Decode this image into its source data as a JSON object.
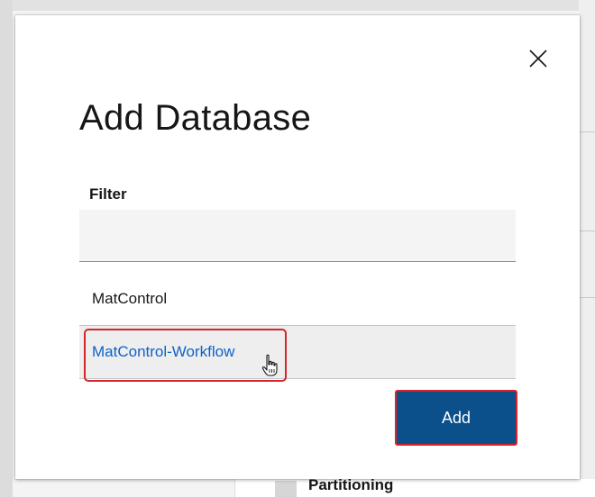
{
  "background": {
    "peek_label": "Partitioning"
  },
  "modal": {
    "title": "Add Database",
    "close_icon": "close-icon",
    "filter": {
      "label": "Filter",
      "value": "",
      "placeholder": ""
    },
    "databases": [
      {
        "name": "MatControl",
        "selected": false
      },
      {
        "name": "MatControl-Workflow",
        "selected": true
      }
    ],
    "add_label": "Add"
  },
  "colors": {
    "primary_button": "#0b4f8b",
    "selected_link": "#0f62c8",
    "highlight": "#d6242b"
  }
}
